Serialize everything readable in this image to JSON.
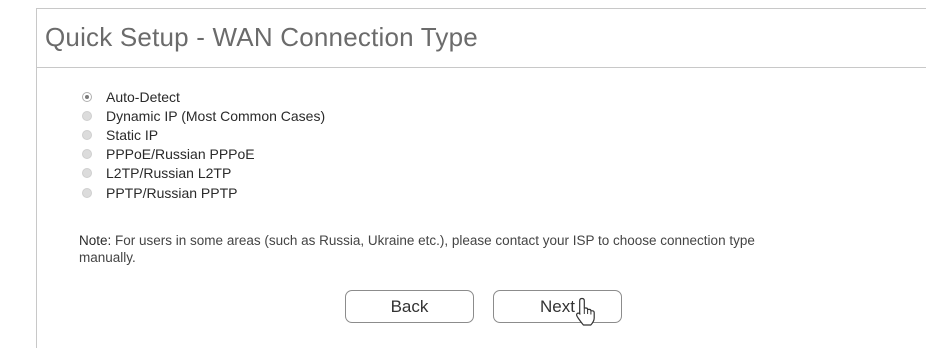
{
  "page": {
    "title": "Quick Setup - WAN Connection Type"
  },
  "connection_types": [
    {
      "label": "Auto-Detect",
      "selected": true
    },
    {
      "label": "Dynamic IP (Most Common Cases)",
      "selected": false
    },
    {
      "label": "Static IP",
      "selected": false
    },
    {
      "label": "PPPoE/Russian PPPoE",
      "selected": false
    },
    {
      "label": "L2TP/Russian L2TP",
      "selected": false
    },
    {
      "label": "PPTP/Russian PPTP",
      "selected": false
    }
  ],
  "note": {
    "label": "Note:",
    "text": " For users in some areas (such as Russia, Ukraine etc.), please contact your ISP to choose connection type manually."
  },
  "buttons": {
    "back_label": "Back",
    "next_label": "Next"
  },
  "icons": {
    "cursor": "mouse-pointer-icon"
  }
}
